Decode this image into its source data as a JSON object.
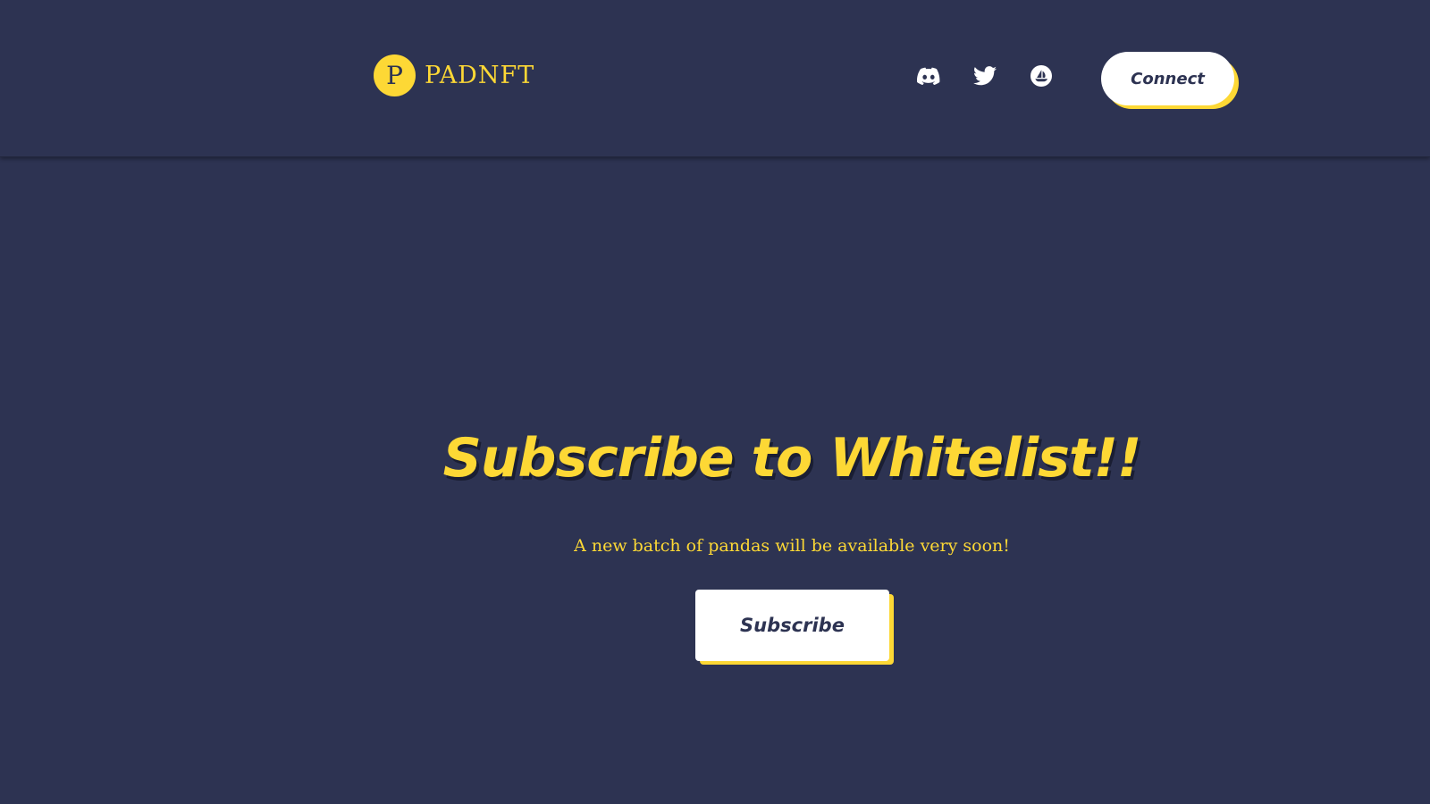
{
  "header": {
    "logo_letter": "P",
    "brand": "PADNFT",
    "social": [
      {
        "icon": "discord-icon"
      },
      {
        "icon": "twitter-icon"
      },
      {
        "icon": "opensea-icon"
      }
    ],
    "connect_label": "Connect"
  },
  "hero": {
    "headline": "Subscribe to Whitelist!!",
    "subtext": "A new batch of pandas will be available very soon!",
    "subscribe_label": "Subscribe"
  },
  "colors": {
    "background": "#2d3352",
    "accent": "#fdd835",
    "button_bg": "#ffffff",
    "button_text": "#2d3352"
  }
}
